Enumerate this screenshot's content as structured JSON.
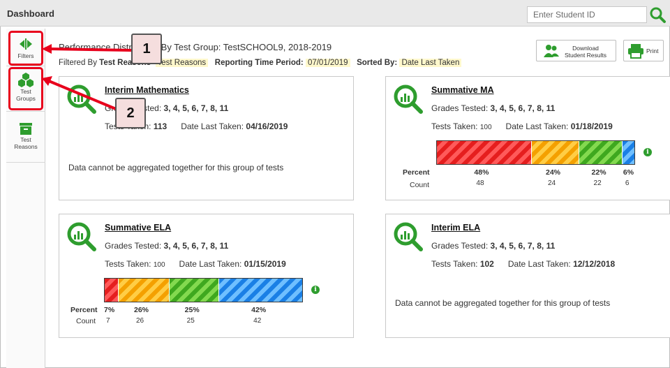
{
  "header": {
    "title": "Dashboard",
    "search_placeholder": "Enter Student ID"
  },
  "sidebar": {
    "items": [
      {
        "label": "Filters"
      },
      {
        "label_line1": "Test",
        "label_line2": "Groups"
      },
      {
        "label_line1": "Test",
        "label_line2": "Reasons"
      }
    ]
  },
  "toolbar": {
    "title": "Performance Distribution By Test Group: TestSCHOOL9, 2018-2019",
    "filtered_by_label": "Filtered By",
    "filtered_by_value": "Test Reasons",
    "filter_value_2": "Test Reasons",
    "period_label": "Reporting Time Period:",
    "period_value": "07/01/2019",
    "sorted_label": "Sorted By:",
    "sorted_value": "Date Last Taken",
    "download_line1": "Download",
    "download_line2": "Student Results",
    "print_label": "Print"
  },
  "cards": [
    {
      "title": "Interim Mathematics",
      "grades_label": "Grades Tested:",
      "grades": "3, 4, 5, 6, 7, 8, 11",
      "tests_label": "Tests Taken:",
      "tests": "113",
      "date_label": "Date Last Taken:",
      "date": "04/16/2019",
      "message": "Data cannot be aggregated together for this group of tests"
    },
    {
      "title": "Summative MA",
      "grades_label": "Grades Tested:",
      "grades": "3, 4, 5, 6, 7, 8, 11",
      "tests_label": "Tests Taken:",
      "tests": "100",
      "date_label": "Date Last Taken:",
      "date": "01/18/2019",
      "percent_label": "Percent",
      "count_label": "Count",
      "distribution": [
        {
          "percent": "48%",
          "count": "48",
          "value": 48,
          "color": "red"
        },
        {
          "percent": "24%",
          "count": "24",
          "value": 24,
          "color": "orange"
        },
        {
          "percent": "22%",
          "count": "22",
          "value": 22,
          "color": "green"
        },
        {
          "percent": "6%",
          "count": "6",
          "value": 6,
          "color": "blue"
        }
      ]
    },
    {
      "title": "Summative ELA",
      "grades_label": "Grades Tested:",
      "grades": "3, 4, 5, 6, 7, 8, 11",
      "tests_label": "Tests Taken:",
      "tests": "100",
      "date_label": "Date Last Taken:",
      "date": "01/15/2019",
      "percent_label": "Percent",
      "count_label": "Count",
      "distribution": [
        {
          "percent": "7%",
          "count": "7",
          "value": 7,
          "color": "red"
        },
        {
          "percent": "26%",
          "count": "26",
          "value": 26,
          "color": "orange"
        },
        {
          "percent": "25%",
          "count": "25",
          "value": 25,
          "color": "green"
        },
        {
          "percent": "42%",
          "count": "42",
          "value": 42,
          "color": "blue"
        }
      ]
    },
    {
      "title": "Interim ELA",
      "grades_label": "Grades Tested:",
      "grades": "3, 4, 5, 6, 7, 8, 11",
      "tests_label": "Tests Taken:",
      "tests": "102",
      "date_label": "Date Last Taken:",
      "date": "12/12/2018",
      "message": "Data cannot be aggregated together for this group of tests"
    }
  ],
  "callouts": [
    {
      "number": "1"
    },
    {
      "number": "2"
    }
  ],
  "colors": {
    "accent_green": "#2e9d2e",
    "callout_red": "#e8001c",
    "header_bg": "#e9e9e9"
  }
}
